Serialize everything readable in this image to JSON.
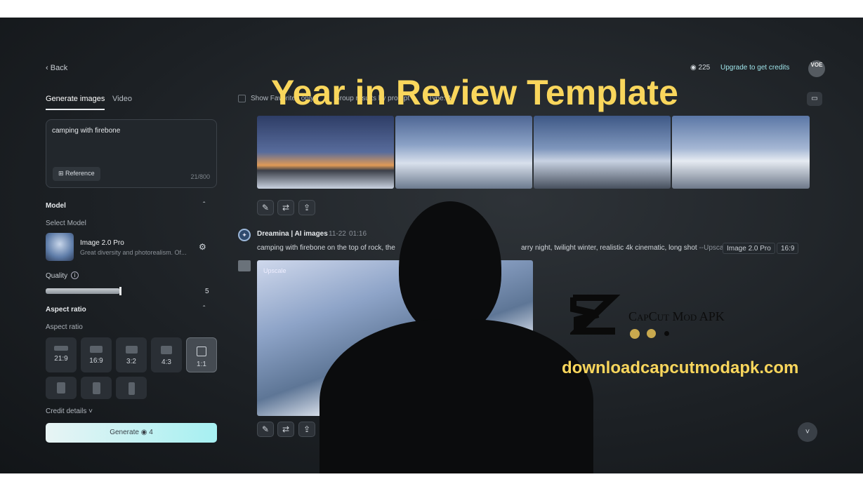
{
  "overlay": {
    "title": "Year in Review Template",
    "brand": "CapCut Mod APK",
    "website": "downloadcapcutmodapk.com",
    "title_color": "#f9d65c"
  },
  "nav": {
    "back": "Back"
  },
  "header": {
    "credits": "225",
    "upgrade": "Upgrade to get credits",
    "avatar": "VOE"
  },
  "tabs": [
    {
      "label": "Generate images",
      "active": true
    },
    {
      "label": "Video",
      "active": false
    }
  ],
  "prompt": {
    "value": "camping with firebone",
    "reference": "Reference",
    "counter": "21/800"
  },
  "model": {
    "section": "Model",
    "select_label": "Select Model",
    "name": "Image 2.0 Pro",
    "description": "Great diversity and photorealism. Of..."
  },
  "quality": {
    "label": "Quality",
    "value": "5",
    "fraction": 0.5
  },
  "aspect": {
    "section": "Aspect ratio",
    "label": "Aspect ratio",
    "options": [
      "21:9",
      "16:9",
      "3:2",
      "4:3",
      "1:1"
    ],
    "selected": "1:1"
  },
  "credit_details": "Credit details",
  "generate": {
    "label": "Generate",
    "cost": "4"
  },
  "filters": {
    "favorites": "Show Favorites only",
    "group": "Group results by prompt",
    "type": "Type: All"
  },
  "result": {
    "author": "Dreamina | AI images",
    "date": "11-22",
    "time": "01:16",
    "prompt_start": "camping with firebone on the top of rock, the",
    "prompt_end": "arry night, twilight winter, realistic 4k cinematic, long shot",
    "suffix": "--Upscaled",
    "model_tag": "Image 2.0 Pro",
    "ratio_tag": "16:9",
    "upscale_label": "Upscale"
  }
}
